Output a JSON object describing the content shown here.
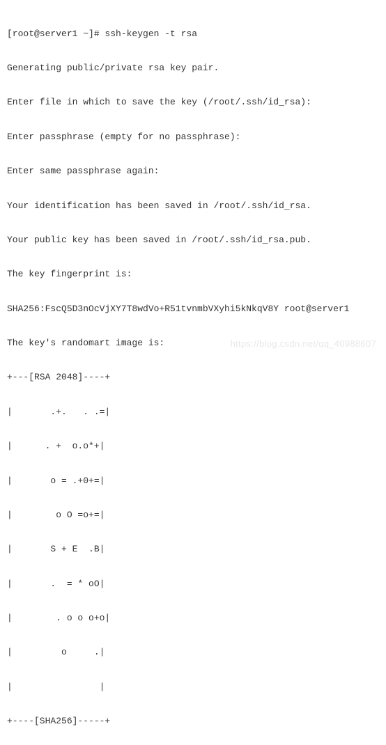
{
  "terminal": {
    "lines": [
      "[root@server1 ~]# ssh-keygen -t rsa",
      "Generating public/private rsa key pair.",
      "Enter file in which to save the key (/root/.ssh/id_rsa):",
      "Enter passphrase (empty for no passphrase):",
      "Enter same passphrase again:",
      "Your identification has been saved in /root/.ssh/id_rsa.",
      "Your public key has been saved in /root/.ssh/id_rsa.pub.",
      "The key fingerprint is:",
      "SHA256:FscQ5D3nOcVjXY7T8wdVo+R51tvnmbVXyhi5kNkqV8Y root@server1",
      "The key's randomart image is:",
      "+---[RSA 2048]----+",
      "|       .+.   . .=|",
      "|      . +  o.o*+|",
      "|       o = .+0+=|",
      "|        o O =o+=|",
      "|       S + E  .B|",
      "|       .  = * oO|",
      "|        . o o o+o|",
      "|         o     .|",
      "|                |",
      "+----[SHA256]-----+"
    ]
  },
  "watermark": {
    "text": "https://blog.csdn.net/qq_40988607"
  }
}
